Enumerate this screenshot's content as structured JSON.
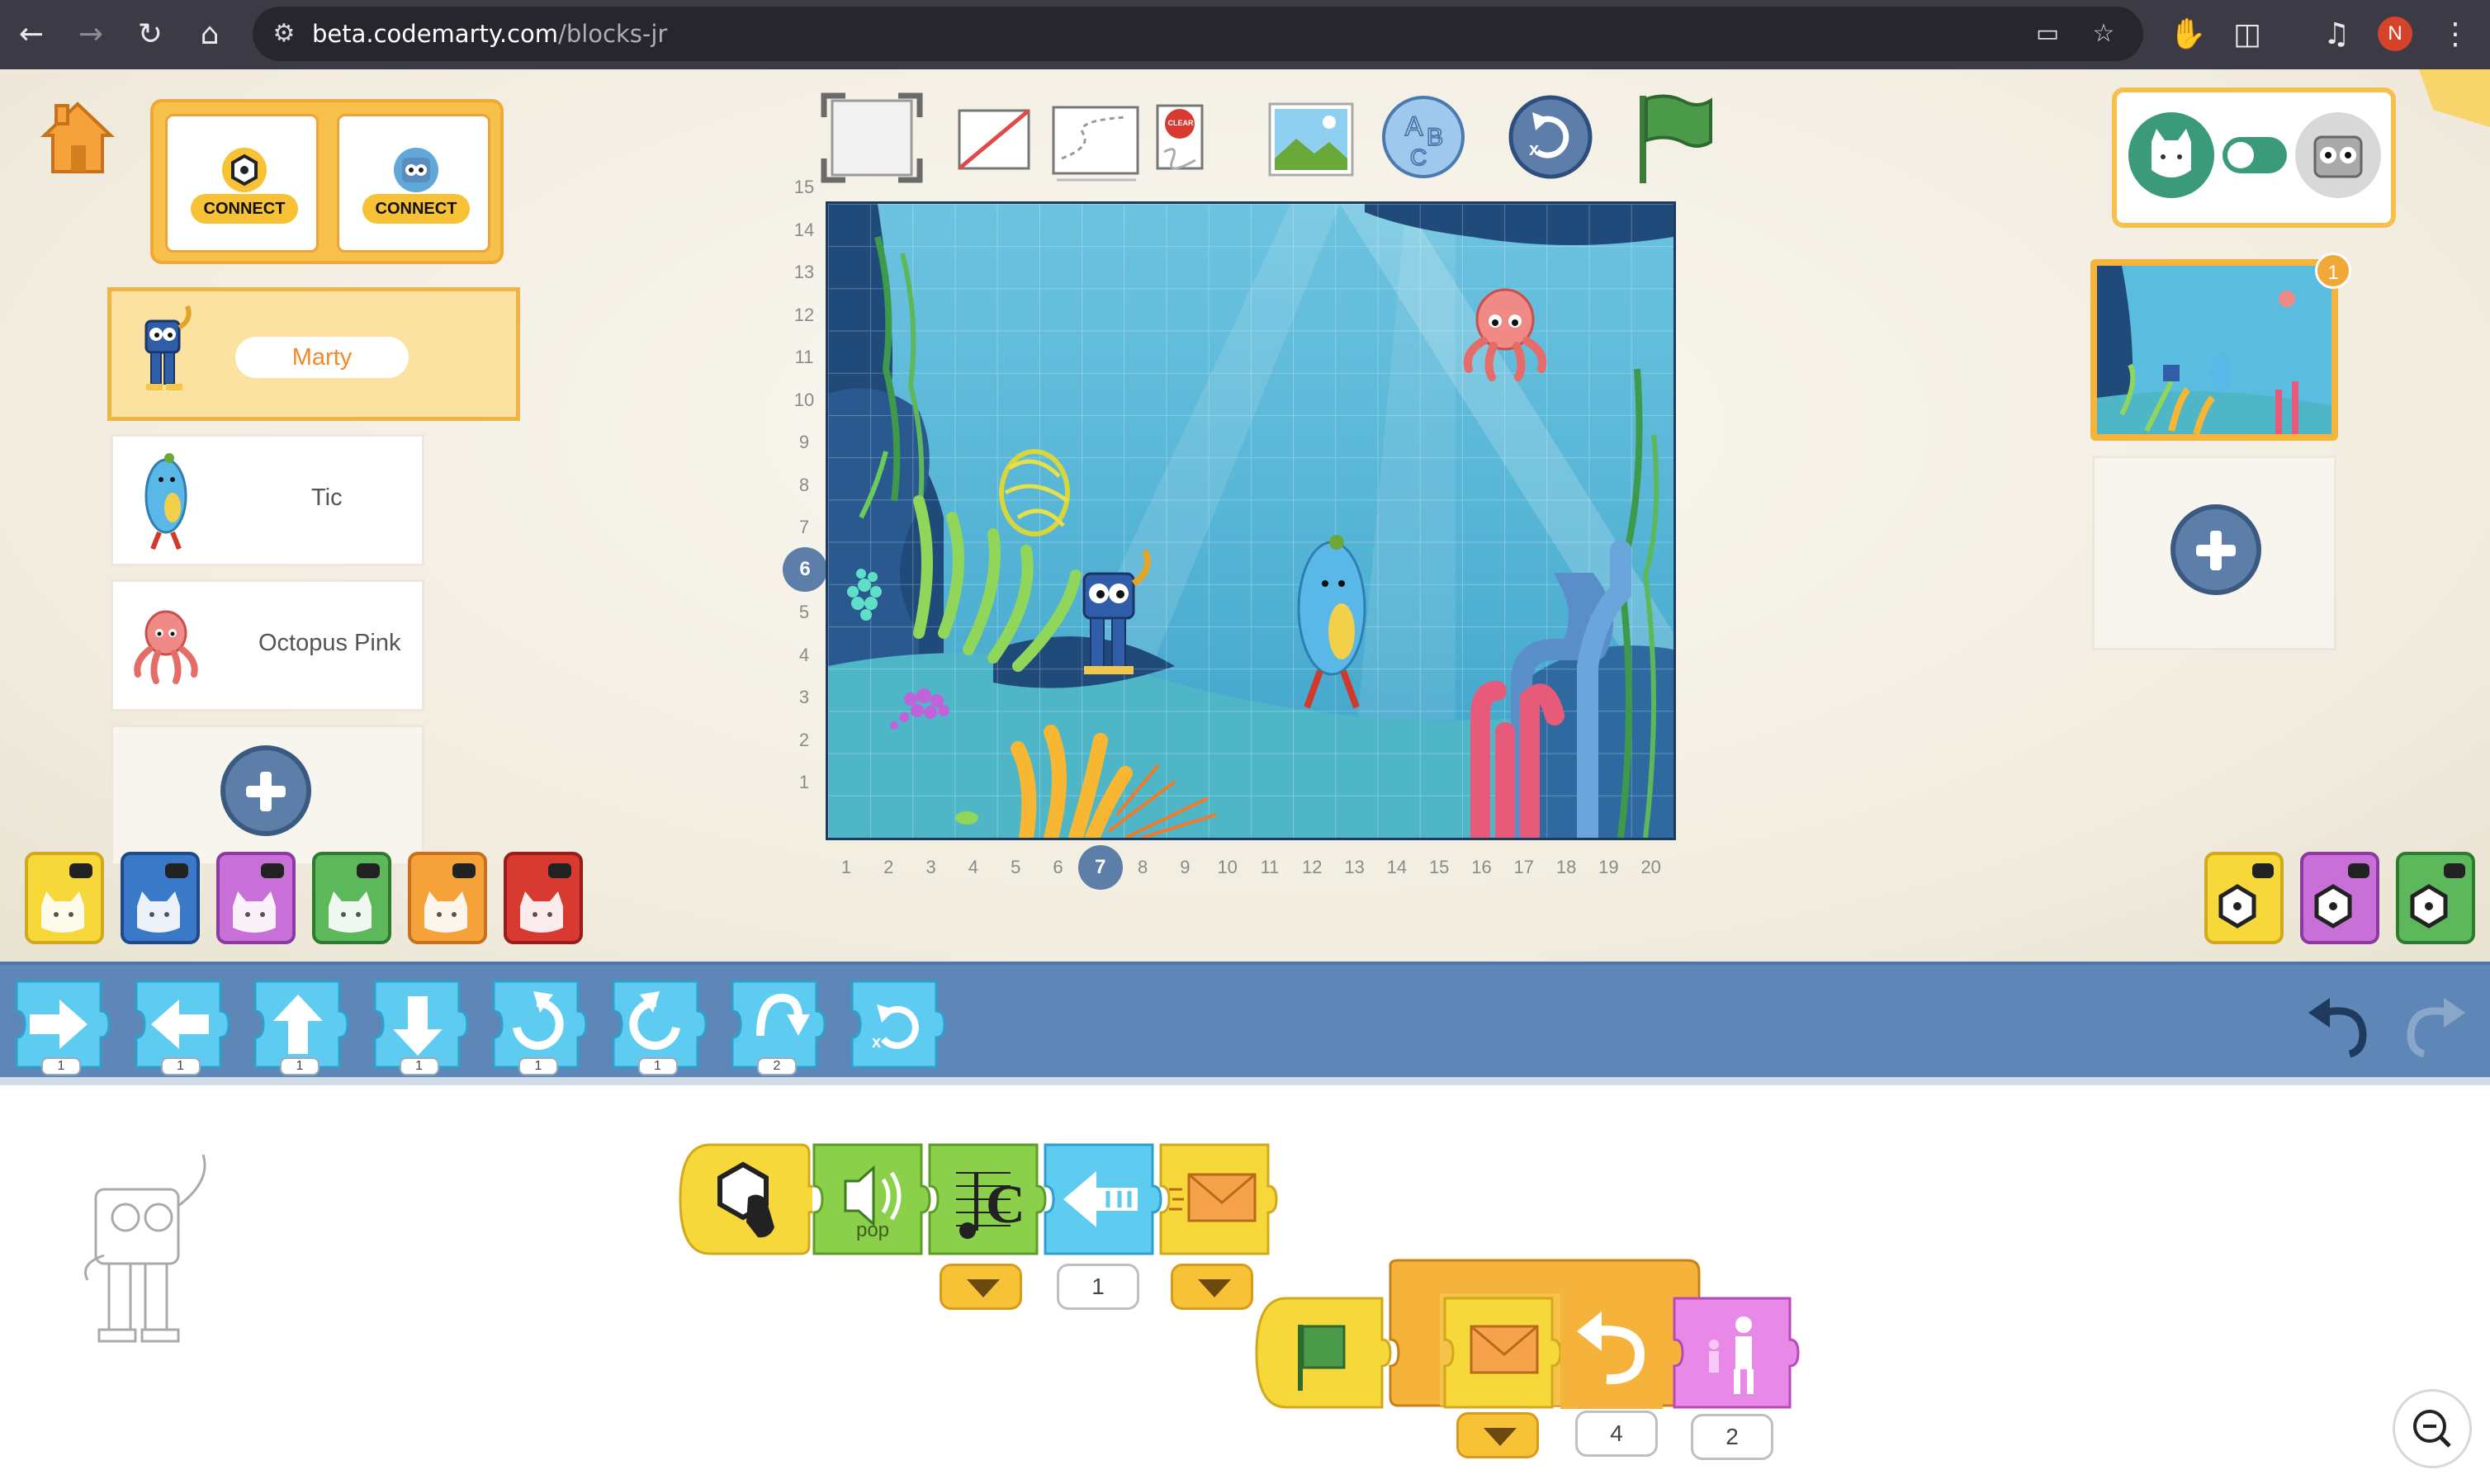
{
  "browser": {
    "url_host": "beta.codemarty.com",
    "url_path": "/blocks-jr",
    "profile_initial": "N",
    "nav": {
      "back": "←",
      "forward": "→",
      "reload": "↻",
      "home": "⌂"
    }
  },
  "devices": {
    "connect_1": {
      "label": "CONNECT",
      "icon": "cog-hex-icon"
    },
    "connect_2": {
      "label": "CONNECT",
      "icon": "marty-face-icon"
    }
  },
  "sprites": [
    {
      "name": "Marty",
      "selected": true
    },
    {
      "name": "Tic",
      "selected": false
    },
    {
      "name": "Octopus Pink",
      "selected": false
    }
  ],
  "toolbar": {
    "tools": [
      "fullscreen-icon",
      "grid-off-icon",
      "path-icon",
      "clear-icon",
      "background-icon",
      "text-icon",
      "reset-position-icon",
      "green-flag-icon"
    ],
    "clear_label": "CLEAR"
  },
  "stage": {
    "y_axis": [
      "15",
      "14",
      "13",
      "12",
      "11",
      "10",
      "9",
      "8",
      "7",
      "6",
      "5",
      "4",
      "3",
      "2",
      "1"
    ],
    "x_axis": [
      "1",
      "2",
      "3",
      "4",
      "5",
      "6",
      "7",
      "8",
      "9",
      "10",
      "11",
      "12",
      "13",
      "14",
      "15",
      "16",
      "17",
      "18",
      "19",
      "20"
    ],
    "selected_x": "7",
    "selected_y": "6"
  },
  "pages": {
    "count_badge": "1"
  },
  "categories": [
    "triggers",
    "motion",
    "looks",
    "sound",
    "control",
    "end"
  ],
  "device_categories": [
    "hex-triggers",
    "hex-looks",
    "hex-sound"
  ],
  "palette": [
    {
      "name": "move-right",
      "value": "1"
    },
    {
      "name": "move-left",
      "value": "1"
    },
    {
      "name": "move-up",
      "value": "1"
    },
    {
      "name": "move-down",
      "value": "1"
    },
    {
      "name": "turn-right",
      "value": "1"
    },
    {
      "name": "turn-left",
      "value": "1"
    },
    {
      "name": "hop",
      "value": "2"
    },
    {
      "name": "go-home",
      "value": ""
    }
  ],
  "script_1": {
    "sound_label": "pop",
    "move_value": "1"
  },
  "script_2": {
    "repeat_value": "4",
    "grow_value": "2"
  },
  "colors": {
    "motion": "#5ecbf0",
    "sound": "#8bd04a",
    "trigger": "#f7d83a",
    "control": "#f5b33c",
    "looks": "#e889e8",
    "accent": "#5c7ea8"
  }
}
